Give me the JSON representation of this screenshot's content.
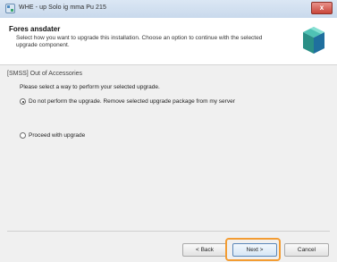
{
  "window": {
    "title": "WHE - up Solo ig mma Pu 215",
    "close_label": "x"
  },
  "header": {
    "title": "Fores ansdater",
    "description": "Select how you want to upgrade this installation. Choose an option to continue with the selected upgrade component."
  },
  "section": {
    "label": "[SMSS] Out of Accessories"
  },
  "options": {
    "question": "Please select a way to perform your selected upgrade.",
    "items": [
      {
        "label": "Do not perform the upgrade. Remove selected upgrade package from my server",
        "checked": true
      },
      {
        "label": "Proceed with upgrade",
        "checked": false
      }
    ]
  },
  "buttons": {
    "back": "< Back",
    "next": "Next >",
    "cancel": "Cancel"
  },
  "colors": {
    "highlight": "#f39c32",
    "titlebar": "#c9d9ec",
    "close": "#c9463a"
  }
}
